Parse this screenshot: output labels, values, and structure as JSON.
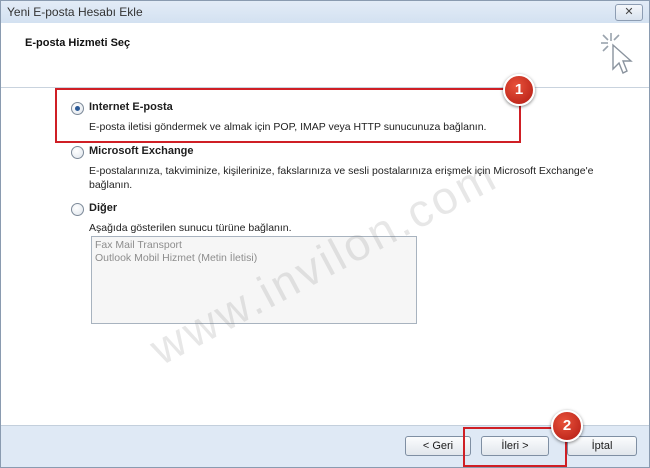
{
  "window": {
    "title": "Yeni E-posta Hesabı Ekle",
    "close_label": "✕"
  },
  "header": {
    "title": "E-posta Hizmeti Seç",
    "icon": "cursor-sparkle-icon"
  },
  "options": [
    {
      "label": "Internet E-posta",
      "description": "E-posta iletisi göndermek ve almak için POP, IMAP veya HTTP sunucunuza bağlanın.",
      "selected": true
    },
    {
      "label": "Microsoft Exchange",
      "description": "E-postalarınıza, takviminize, kişilerinize, fakslarınıza ve sesli postalarınıza erişmek için Microsoft Exchange'e bağlanın.",
      "selected": false
    },
    {
      "label": "Diğer",
      "description": "Aşağıda gösterilen sunucu türüne bağlanın.",
      "selected": false
    }
  ],
  "server_list": [
    "Fax Mail Transport",
    "Outlook Mobil Hizmet (Metin İletisi)"
  ],
  "annotations": {
    "badge_1": "1",
    "badge_2": "2",
    "color": "#cf1f25"
  },
  "watermark": "www.invilon.com",
  "footer": {
    "back_label": "< Geri",
    "next_label": "İleri >",
    "cancel_label": "İptal"
  }
}
